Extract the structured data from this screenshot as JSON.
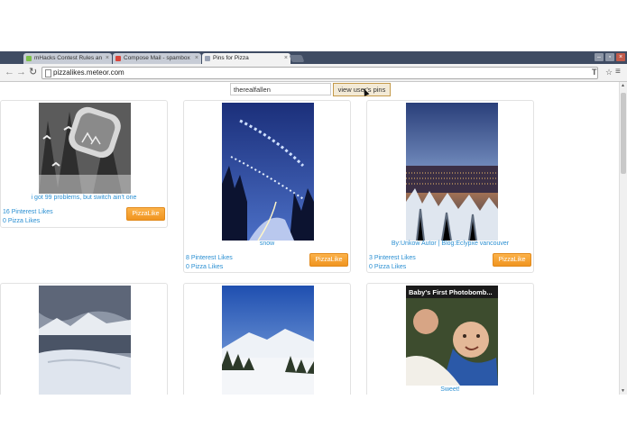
{
  "tabs": [
    {
      "label": "mHacks Contest Rules an",
      "icon": "mhacks-favicon",
      "color": "#7bbf4a",
      "active": false
    },
    {
      "label": "Compose Mail - spambox",
      "icon": "gmail-favicon",
      "color": "#d9453b",
      "active": false
    },
    {
      "label": "Pins for Pizza",
      "icon": "page-favicon",
      "color": "#9aa3b5",
      "active": true
    }
  ],
  "toolbar": {
    "back": "←",
    "forward": "→",
    "reload": "↻",
    "url": "pizzalikes.meteor.com",
    "ext_icon": "T",
    "menu_icon": "≡"
  },
  "window": {
    "minimize": "–",
    "restore": "▫",
    "close": "×"
  },
  "search": {
    "username": "therealfallen",
    "button": "view user's pins"
  },
  "pins": [
    {
      "caption": "i got 99 problems, but switch ain't one",
      "pinterest": "16 Pinterest Likes",
      "pizza": "0 Pizza Likes",
      "button": "PizzaLike"
    },
    {
      "caption": "snow",
      "pinterest": "8 Pinterest Likes",
      "pizza": "0 Pizza Likes",
      "button": "PizzaLike"
    },
    {
      "caption": "By:Unkow Autor | Blog:Eclypxe vancouver",
      "pinterest": "3 Pinterest Likes",
      "pizza": "0 Pizza Likes",
      "button": "PizzaLike"
    },
    {
      "caption": "",
      "pinterest": "",
      "pizza": "",
      "button": ""
    },
    {
      "caption": "",
      "pinterest": "",
      "pizza": "",
      "button": ""
    },
    {
      "caption": "Sweet!",
      "photo_text": "Baby's First Photobomb...",
      "pinterest": "",
      "pizza": "",
      "button": ""
    }
  ],
  "colors": {
    "link": "#2a8fd2",
    "button": "#f0941f",
    "tabstrip": "#3f4c63"
  }
}
